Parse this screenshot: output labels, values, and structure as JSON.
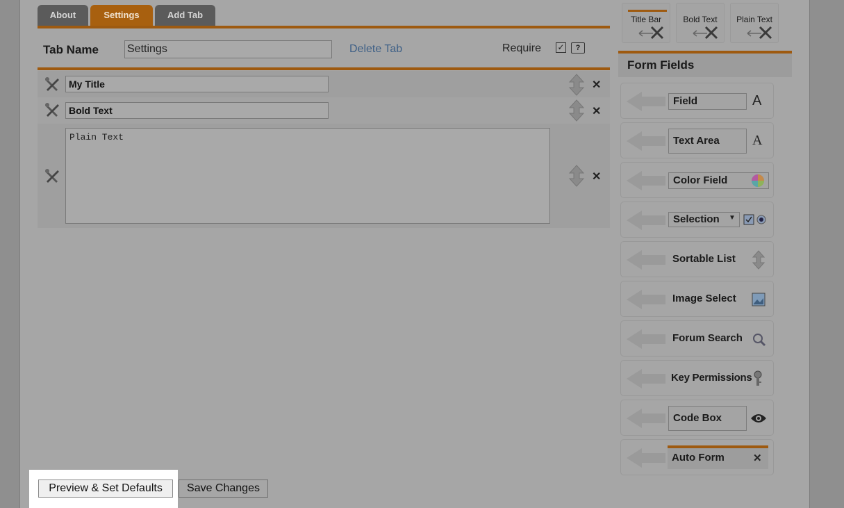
{
  "tabs": [
    {
      "label": "About"
    },
    {
      "label": "Settings"
    },
    {
      "label": "Add Tab"
    }
  ],
  "tab_name": {
    "label": "Tab Name",
    "value": "Settings"
  },
  "delete_tab_label": "Delete Tab",
  "require": {
    "label": "Require",
    "checked": true,
    "check_glyph": "✓",
    "help_glyph": "?"
  },
  "fields": [
    {
      "type": "text",
      "value": "My Title"
    },
    {
      "type": "text",
      "value": "Bold Text"
    },
    {
      "type": "textarea",
      "value": "Plain Text"
    }
  ],
  "templates": [
    {
      "label": "Title Bar"
    },
    {
      "label": "Bold Text"
    },
    {
      "label": "Plain Text"
    }
  ],
  "form_fields": {
    "title": "Form Fields",
    "items": [
      {
        "label": "Field",
        "icon": "letter-a-icon"
      },
      {
        "label": "Text Area",
        "icon": "letter-a-outline-icon"
      },
      {
        "label": "Color Field",
        "icon": "color-wheel-icon"
      },
      {
        "label": "Selection",
        "icon": "checkbox-radio-icon"
      },
      {
        "label": "Sortable List",
        "icon": "updown-icon"
      },
      {
        "label": "Image Select",
        "icon": "image-icon"
      },
      {
        "label": "Forum Search",
        "icon": "magnifier-icon"
      },
      {
        "label": "Key Permissions",
        "icon": "key-icon"
      },
      {
        "label": "Code Box",
        "icon": "eye-icon"
      },
      {
        "label": "Auto Form",
        "icon": "close-icon"
      }
    ]
  },
  "buttons": {
    "preview": "Preview & Set Defaults",
    "save": "Save Changes"
  },
  "glyphs": {
    "close": "✕",
    "letter_a": "A"
  },
  "colors": {
    "accent": "#9e5a10",
    "link": "#3d5f86"
  }
}
